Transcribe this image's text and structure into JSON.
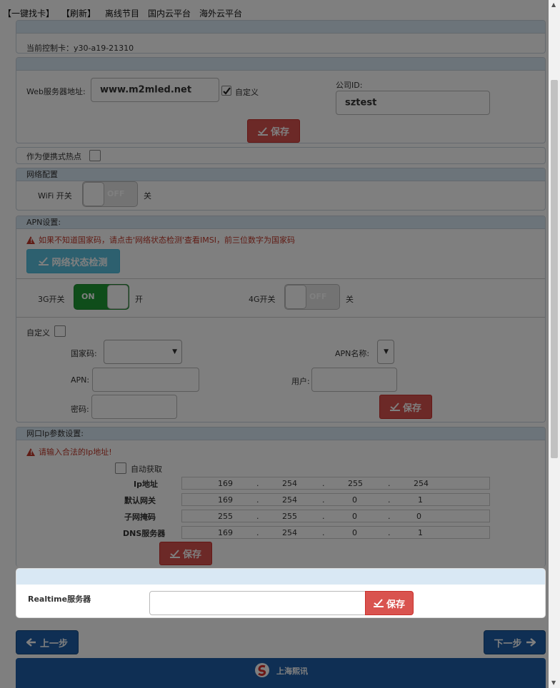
{
  "nav": {
    "items": [
      "【一键找卡】",
      "【刷新】",
      "离线节目",
      "国内云平台",
      "海外云平台"
    ]
  },
  "card": {
    "current_label": "当前控制卡：y30-a19-21310"
  },
  "web": {
    "server_label": "Web服务器地址:",
    "server_value": "www.m2mled.net",
    "custom_label": "自定义",
    "company_label": "公司ID:",
    "company_value": "sztest",
    "save_label": "保存"
  },
  "hotspot": {
    "label": "作为便携式热点"
  },
  "network": {
    "title": "网络配置",
    "wifi_label": "WiFi 开关",
    "wifi_state": "OFF",
    "wifi_text": "关"
  },
  "apn": {
    "title": "APN设置:",
    "warning": "如果不知道国家码，请点击'网络状态检测'查看IMSI，前三位数字为国家码",
    "detect_label": "网络状态检测",
    "g3_label": "3G开关",
    "g3_state": "ON",
    "g3_text": "开",
    "g4_label": "4G开关",
    "g4_state": "OFF",
    "g4_text": "关",
    "custom_label": "自定义",
    "country_label": "国家码:",
    "apn_name_label": "APN名称:",
    "apn_label": "APN:",
    "user_label": "用户:",
    "password_label": "密码:",
    "save_label": "保存"
  },
  "ip": {
    "title": "网口Ip参数设置:",
    "warning": "请输入合法的Ip地址!",
    "auto_label": "自动获取",
    "rows": [
      {
        "label": "Ip地址",
        "values": [
          "169",
          "254",
          "255",
          "254"
        ]
      },
      {
        "label": "默认网关",
        "values": [
          "169",
          "254",
          "0",
          "1"
        ]
      },
      {
        "label": "子网掩码",
        "values": [
          "255",
          "255",
          "0",
          "0"
        ]
      },
      {
        "label": "DNS服务器",
        "values": [
          "169",
          "254",
          "0",
          "1"
        ]
      }
    ],
    "save_label": "保存"
  },
  "modal": {
    "label": "Realtime服务器",
    "input_value": "",
    "save_label": "保存"
  },
  "footer": {
    "prev_label": "上一步",
    "next_label": "下一步",
    "brand": "上海熙讯"
  },
  "colors": {
    "primary": "#1f5fa8",
    "danger": "#d9534f",
    "info": "#5bc0de",
    "success": "#1e9a34",
    "panel_head": "#d9e8f4"
  }
}
